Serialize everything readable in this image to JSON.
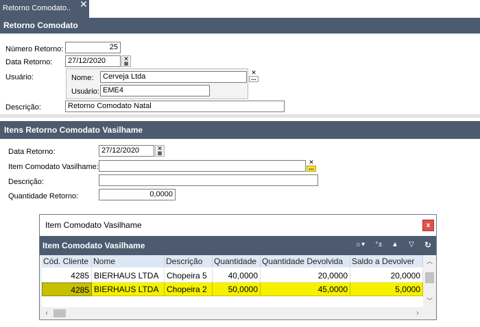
{
  "tab": {
    "label": "Retorno Comodato..",
    "close": "✕"
  },
  "header": {
    "title": "Retorno Comodato"
  },
  "form": {
    "numero_label": "Número Retorno:",
    "numero_value": "25",
    "data_label": "Data Retorno:",
    "data_value": "27/12/2020",
    "usuario_label": "Usuário:",
    "nome_label": "Nome:",
    "nome_value": "Cerveja Ltda",
    "usuario_inner_label": "Usuário:",
    "usuario_value": "EME4",
    "descricao_label": "Descrição:",
    "descricao_value": "Retorno Comodato Natal"
  },
  "itens": {
    "title": "Itens Retorno Comodato Vasilhame",
    "data_label": "Data Retorno:",
    "data_value": "27/12/2020",
    "item_label": "Item Comodato Vasilhame:",
    "item_value": "",
    "descricao_label": "Descrição:",
    "descricao_value": "",
    "quantidade_label": "Quantidade Retorno:",
    "quantidade_value": "0,0000"
  },
  "dialog": {
    "title": "Item Comodato Vasilhame",
    "close": "x",
    "header": "Item Comodato Vasilhame",
    "toolbar": {
      "settings_icon": "☼▾",
      "add_icon": "⁺±",
      "up_icon": "▲",
      "filter_icon": "▽",
      "refresh_icon": "↻"
    },
    "columns": [
      "Cód. Cliente",
      "Nome",
      "Descrição",
      "Quantidade",
      "Quantidade Devolvida",
      "Saldo a Devolver"
    ],
    "rows": [
      [
        "4285",
        "BIERHAUS  LTDA",
        "Chopeira 5",
        "40,0000",
        "20,0000",
        "20,0000"
      ],
      [
        "4285",
        "BIERHAUS  LTDA",
        "Chopeira 2",
        "50,0000",
        "45,0000",
        "5,0000"
      ]
    ]
  }
}
